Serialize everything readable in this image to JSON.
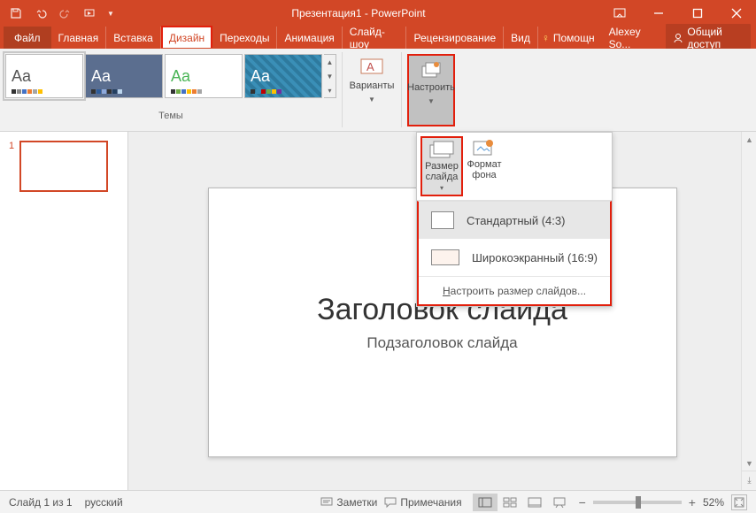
{
  "titlebar": {
    "title": "Презентация1 - PowerPoint"
  },
  "tabs": {
    "file": "Файл",
    "items": [
      "Главная",
      "Вставка",
      "Дизайн",
      "Переходы",
      "Анимация",
      "Слайд-шоу",
      "Рецензирование",
      "Вид"
    ],
    "active": "Дизайн",
    "help": "Помощн",
    "user": "Alexey So...",
    "share": "Общий доступ"
  },
  "ribbon": {
    "themes_label": "Темы",
    "variants_label": "Варианты",
    "customize_label": "Настроить"
  },
  "popup": {
    "size_btn": "Размер\nслайда",
    "format_btn": "Формат\nфона",
    "items": [
      {
        "label": "Стандартный (4:3)"
      },
      {
        "label": "Широкоэкранный (16:9)"
      }
    ],
    "custom": "Настроить размер слайдов..."
  },
  "slides": {
    "thumb_num": "1",
    "title": "Заголовок слайда",
    "subtitle": "Подзаголовок слайда"
  },
  "status": {
    "left1": "Слайд 1 из 1",
    "lang": "русский",
    "notes": "Заметки",
    "comments": "Примечания",
    "zoom": "52%"
  }
}
